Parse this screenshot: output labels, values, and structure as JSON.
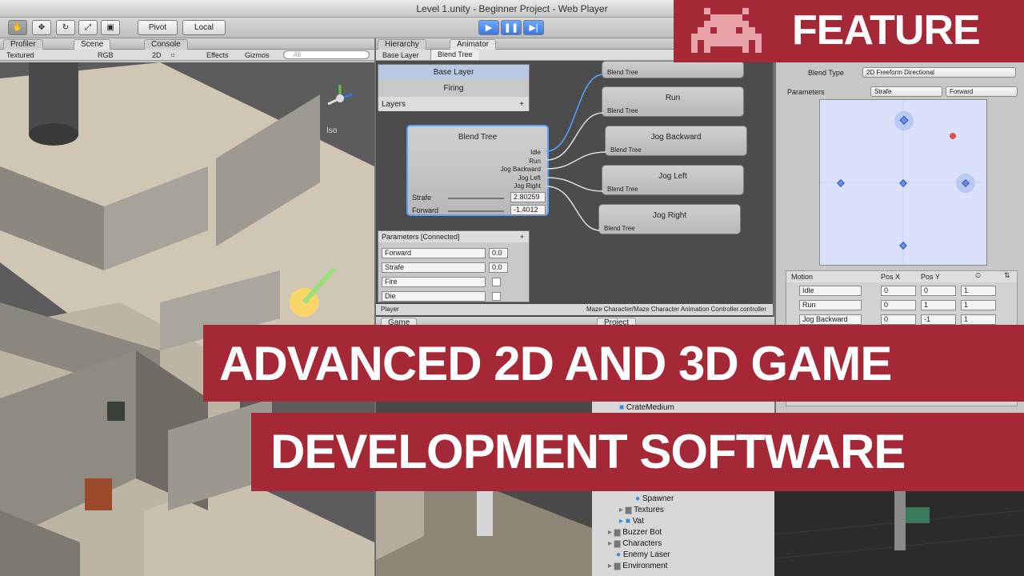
{
  "window": {
    "title": "Level 1.unity - Beginner Project - Web Player"
  },
  "toolbar": {
    "pivot_label": "Pivot",
    "local_label": "Local"
  },
  "scene": {
    "tabs": [
      "Profiler",
      "Scene",
      "Console"
    ],
    "shading": "Textured",
    "render": "RGB",
    "mode2d": "2D",
    "effects": "Effects",
    "gizmos": "Gizmos",
    "search_placeholder": "All",
    "projection": "Iso"
  },
  "animator": {
    "tabs": [
      "Hierarchy",
      "Animator"
    ],
    "breadcrumb": [
      "Base Layer",
      "Blend Tree"
    ],
    "layers": [
      "Base Layer",
      "Firing"
    ],
    "layers_header": "Layers",
    "blend_tree": {
      "title": "Blend Tree",
      "outputs": [
        "Idle",
        "Run",
        "Jog Backward",
        "Jog Left",
        "Jog Right"
      ],
      "strafe_label": "Strafe",
      "strafe_value": "2.80259",
      "forward_label": "Forward",
      "forward_value": "-1.4012"
    },
    "nodes": [
      {
        "title": "",
        "sub": "Blend Tree"
      },
      {
        "title": "Run",
        "sub": "Blend Tree"
      },
      {
        "title": "Jog Backward",
        "sub": "Blend Tree"
      },
      {
        "title": "Jog Left",
        "sub": "Blend Tree"
      },
      {
        "title": "Jog Right",
        "sub": "Blend Tree"
      }
    ],
    "parameters_header": "Parameters [Connected]",
    "parameters": [
      {
        "name": "Forward",
        "value": "0.0"
      },
      {
        "name": "Strafe",
        "value": "0.0"
      },
      {
        "name": "Fire",
        "value": ""
      },
      {
        "name": "Die",
        "value": ""
      }
    ],
    "footer_left": "Player",
    "footer_right": "Maze Character/Maze Character Animation Controller.controller"
  },
  "inspector": {
    "blend_type_label": "Blend Type",
    "blend_type_value": "2D Freeform Directional",
    "parameters_label": "Parameters",
    "param_x": "Strafe",
    "param_y": "Forward",
    "motion_headers": [
      "Motion",
      "Pos X",
      "Pos Y"
    ],
    "motions": [
      {
        "name": "Idle",
        "x": "0",
        "y": "0",
        "speed": "1"
      },
      {
        "name": "Run",
        "x": "0",
        "y": "1",
        "speed": "1"
      },
      {
        "name": "Jog Backward",
        "x": "0",
        "y": "-1",
        "speed": "1"
      }
    ]
  },
  "lower": {
    "game_tab": "Game",
    "project_tab": "Project",
    "project_items": [
      "CrateMedium",
      "Spawner",
      "Textures",
      "Vat",
      "Buzzer Bot",
      "Characters",
      "Enemy Laser",
      "Environment"
    ]
  },
  "overlays": {
    "feature": "FEATURE",
    "line1": "ADVANCED 2D AND 3D GAME",
    "line2": "DEVELOPMENT SOFTWARE"
  },
  "colors": {
    "banner": "#a52836",
    "accent": "#3a78e0"
  }
}
